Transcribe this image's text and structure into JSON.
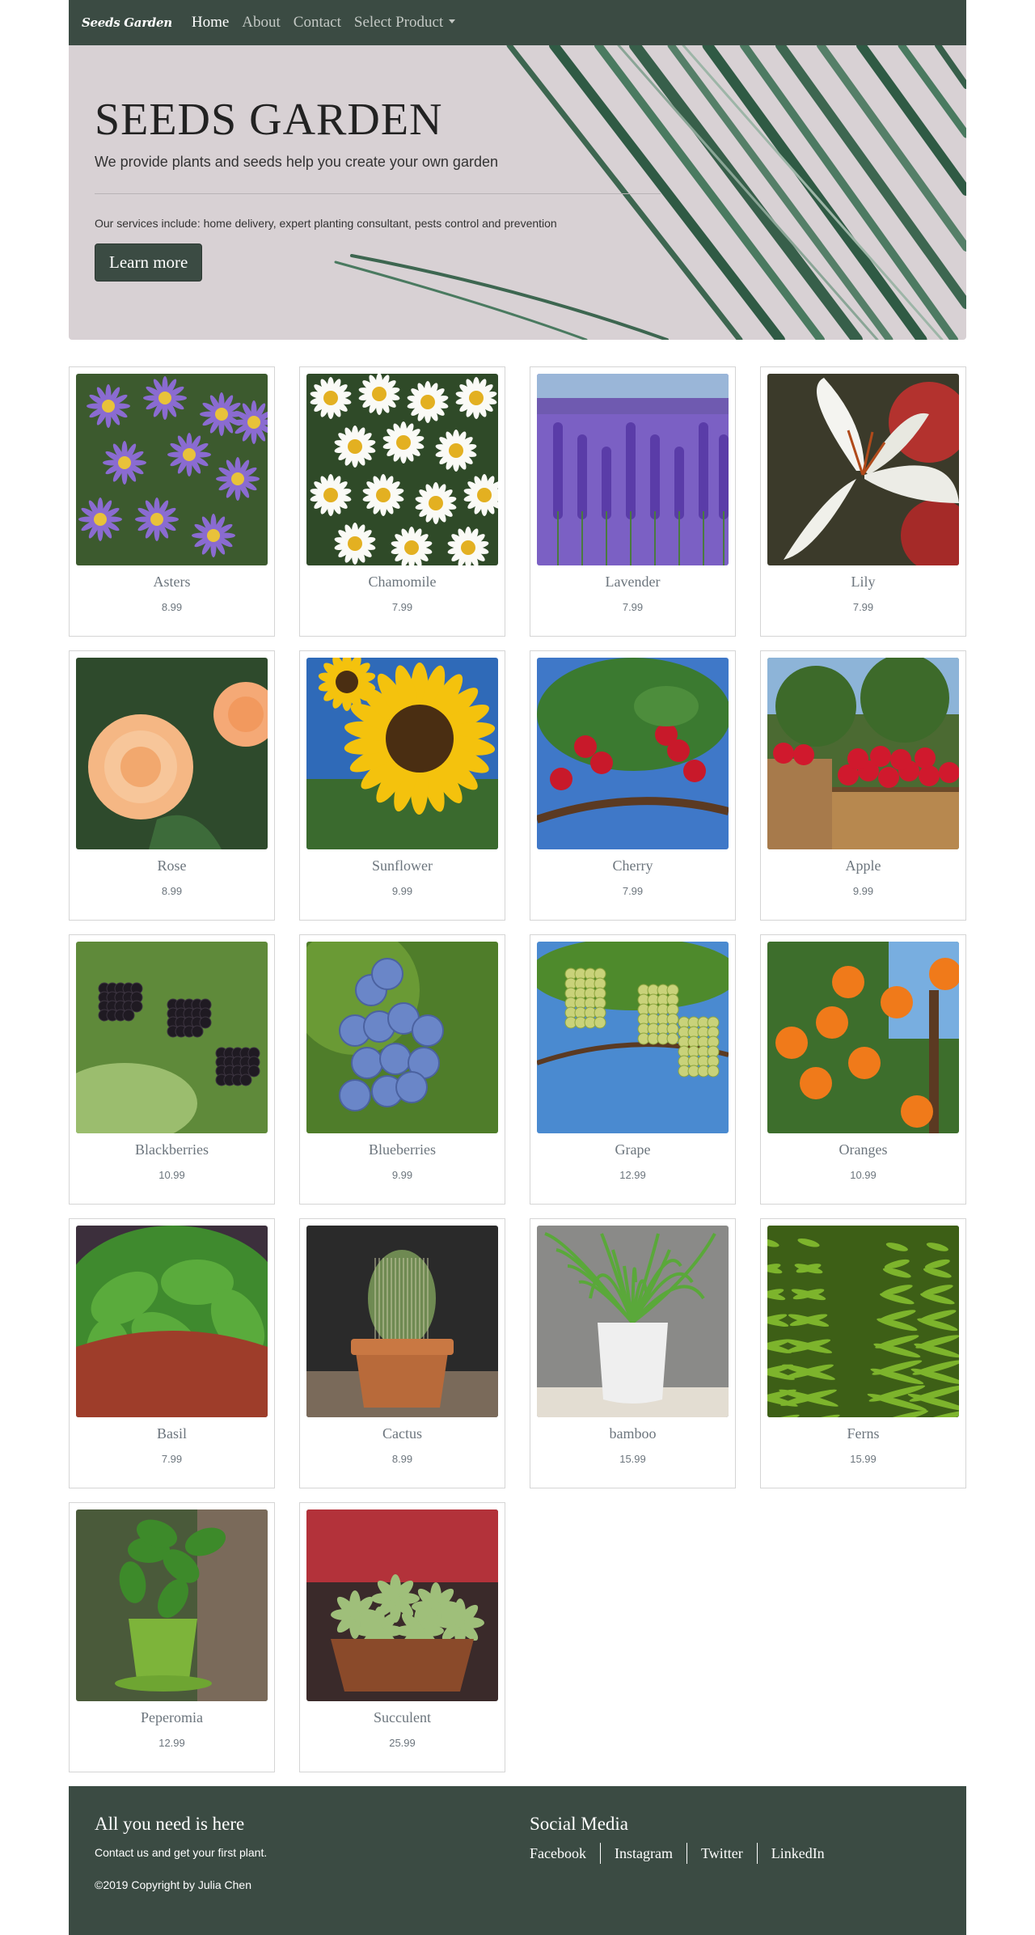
{
  "nav": {
    "brand": "Seeds Garden",
    "links": [
      "Home",
      "About",
      "Contact"
    ],
    "dropdown": "Select Product"
  },
  "hero": {
    "title": "SEEDS GARDEN",
    "lead": "We provide plants and seeds help you create your own garden",
    "services": "Our services include: home delivery, expert planting consultant, pests control and prevention",
    "button": "Learn more"
  },
  "products": [
    {
      "name": "Asters",
      "price": "8.99",
      "icon": "aster-photo"
    },
    {
      "name": "Chamomile",
      "price": "7.99",
      "icon": "chamomile-photo"
    },
    {
      "name": "Lavender",
      "price": "7.99",
      "icon": "lavender-photo"
    },
    {
      "name": "Lily",
      "price": "7.99",
      "icon": "lily-photo"
    },
    {
      "name": "Rose",
      "price": "8.99",
      "icon": "rose-photo"
    },
    {
      "name": "Sunflower",
      "price": "9.99",
      "icon": "sunflower-photo"
    },
    {
      "name": "Cherry",
      "price": "7.99",
      "icon": "cherry-photo"
    },
    {
      "name": "Apple",
      "price": "9.99",
      "icon": "apple-photo"
    },
    {
      "name": "Blackberries",
      "price": "10.99",
      "icon": "blackberry-photo"
    },
    {
      "name": "Blueberries",
      "price": "9.99",
      "icon": "blueberry-photo"
    },
    {
      "name": "Grape",
      "price": "12.99",
      "icon": "grape-photo"
    },
    {
      "name": "Oranges",
      "price": "10.99",
      "icon": "orange-photo"
    },
    {
      "name": "Basil",
      "price": "7.99",
      "icon": "basil-photo"
    },
    {
      "name": "Cactus",
      "price": "8.99",
      "icon": "cactus-photo"
    },
    {
      "name": "bamboo",
      "price": "15.99",
      "icon": "bamboo-photo"
    },
    {
      "name": "Ferns",
      "price": "15.99",
      "icon": "fern-photo"
    },
    {
      "name": "Peperomia",
      "price": "12.99",
      "icon": "peperomia-photo"
    },
    {
      "name": "Succulent",
      "price": "25.99",
      "icon": "succulent-photo"
    }
  ],
  "footer": {
    "title": "All you need is here",
    "text": "Contact us and get your first plant.",
    "copyright": "©2019 Copyright by Julia Chen",
    "social_title": "Social Media",
    "social_links": [
      "Facebook",
      "Instagram",
      "Twitter",
      "LinkedIn"
    ]
  },
  "colors": {
    "nav": "#3b4b43",
    "hero_bg": "#d8d1d4",
    "leaf": "#3f6b52",
    "muted_text": "#6c757d"
  }
}
